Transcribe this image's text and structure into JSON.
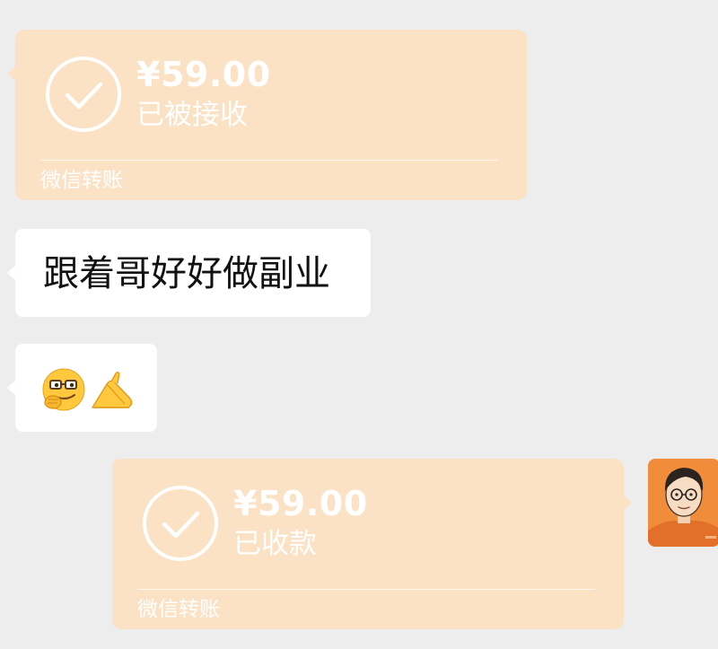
{
  "colors": {
    "background": "#ededed",
    "transfer_card": "#fbe2c5",
    "bubble": "#ffffff",
    "text_dark": "#111111",
    "avatar_bg": "#f08c3a"
  },
  "messages": {
    "received_transfer": {
      "amount": "¥59.00",
      "status": "已被接收",
      "footer": "微信转账",
      "icon": "check-circle-icon"
    },
    "text_message": {
      "text": "跟着哥好好做副业"
    },
    "emoji_message": {
      "emojis": [
        "thinking-face-emoji",
        "clapping-hands-emoji"
      ]
    },
    "sent_transfer": {
      "amount": "¥59.00",
      "status": "已收款",
      "footer": "微信转账",
      "icon": "check-circle-icon"
    }
  },
  "avatar": {
    "icon": "user-avatar-cartoon"
  }
}
